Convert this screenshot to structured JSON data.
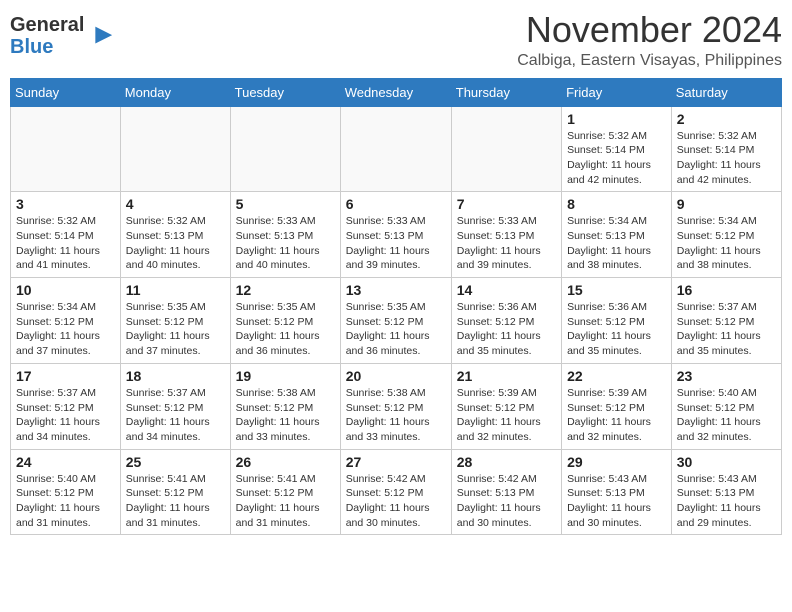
{
  "logo": {
    "general": "General",
    "blue": "Blue"
  },
  "title": "November 2024",
  "location": "Calbiga, Eastern Visayas, Philippines",
  "weekdays": [
    "Sunday",
    "Monday",
    "Tuesday",
    "Wednesday",
    "Thursday",
    "Friday",
    "Saturday"
  ],
  "weeks": [
    [
      {
        "day": "",
        "info": ""
      },
      {
        "day": "",
        "info": ""
      },
      {
        "day": "",
        "info": ""
      },
      {
        "day": "",
        "info": ""
      },
      {
        "day": "",
        "info": ""
      },
      {
        "day": "1",
        "info": "Sunrise: 5:32 AM\nSunset: 5:14 PM\nDaylight: 11 hours and 42 minutes."
      },
      {
        "day": "2",
        "info": "Sunrise: 5:32 AM\nSunset: 5:14 PM\nDaylight: 11 hours and 42 minutes."
      }
    ],
    [
      {
        "day": "3",
        "info": "Sunrise: 5:32 AM\nSunset: 5:14 PM\nDaylight: 11 hours and 41 minutes."
      },
      {
        "day": "4",
        "info": "Sunrise: 5:32 AM\nSunset: 5:13 PM\nDaylight: 11 hours and 40 minutes."
      },
      {
        "day": "5",
        "info": "Sunrise: 5:33 AM\nSunset: 5:13 PM\nDaylight: 11 hours and 40 minutes."
      },
      {
        "day": "6",
        "info": "Sunrise: 5:33 AM\nSunset: 5:13 PM\nDaylight: 11 hours and 39 minutes."
      },
      {
        "day": "7",
        "info": "Sunrise: 5:33 AM\nSunset: 5:13 PM\nDaylight: 11 hours and 39 minutes."
      },
      {
        "day": "8",
        "info": "Sunrise: 5:34 AM\nSunset: 5:13 PM\nDaylight: 11 hours and 38 minutes."
      },
      {
        "day": "9",
        "info": "Sunrise: 5:34 AM\nSunset: 5:12 PM\nDaylight: 11 hours and 38 minutes."
      }
    ],
    [
      {
        "day": "10",
        "info": "Sunrise: 5:34 AM\nSunset: 5:12 PM\nDaylight: 11 hours and 37 minutes."
      },
      {
        "day": "11",
        "info": "Sunrise: 5:35 AM\nSunset: 5:12 PM\nDaylight: 11 hours and 37 minutes."
      },
      {
        "day": "12",
        "info": "Sunrise: 5:35 AM\nSunset: 5:12 PM\nDaylight: 11 hours and 36 minutes."
      },
      {
        "day": "13",
        "info": "Sunrise: 5:35 AM\nSunset: 5:12 PM\nDaylight: 11 hours and 36 minutes."
      },
      {
        "day": "14",
        "info": "Sunrise: 5:36 AM\nSunset: 5:12 PM\nDaylight: 11 hours and 35 minutes."
      },
      {
        "day": "15",
        "info": "Sunrise: 5:36 AM\nSunset: 5:12 PM\nDaylight: 11 hours and 35 minutes."
      },
      {
        "day": "16",
        "info": "Sunrise: 5:37 AM\nSunset: 5:12 PM\nDaylight: 11 hours and 35 minutes."
      }
    ],
    [
      {
        "day": "17",
        "info": "Sunrise: 5:37 AM\nSunset: 5:12 PM\nDaylight: 11 hours and 34 minutes."
      },
      {
        "day": "18",
        "info": "Sunrise: 5:37 AM\nSunset: 5:12 PM\nDaylight: 11 hours and 34 minutes."
      },
      {
        "day": "19",
        "info": "Sunrise: 5:38 AM\nSunset: 5:12 PM\nDaylight: 11 hours and 33 minutes."
      },
      {
        "day": "20",
        "info": "Sunrise: 5:38 AM\nSunset: 5:12 PM\nDaylight: 11 hours and 33 minutes."
      },
      {
        "day": "21",
        "info": "Sunrise: 5:39 AM\nSunset: 5:12 PM\nDaylight: 11 hours and 32 minutes."
      },
      {
        "day": "22",
        "info": "Sunrise: 5:39 AM\nSunset: 5:12 PM\nDaylight: 11 hours and 32 minutes."
      },
      {
        "day": "23",
        "info": "Sunrise: 5:40 AM\nSunset: 5:12 PM\nDaylight: 11 hours and 32 minutes."
      }
    ],
    [
      {
        "day": "24",
        "info": "Sunrise: 5:40 AM\nSunset: 5:12 PM\nDaylight: 11 hours and 31 minutes."
      },
      {
        "day": "25",
        "info": "Sunrise: 5:41 AM\nSunset: 5:12 PM\nDaylight: 11 hours and 31 minutes."
      },
      {
        "day": "26",
        "info": "Sunrise: 5:41 AM\nSunset: 5:12 PM\nDaylight: 11 hours and 31 minutes."
      },
      {
        "day": "27",
        "info": "Sunrise: 5:42 AM\nSunset: 5:12 PM\nDaylight: 11 hours and 30 minutes."
      },
      {
        "day": "28",
        "info": "Sunrise: 5:42 AM\nSunset: 5:13 PM\nDaylight: 11 hours and 30 minutes."
      },
      {
        "day": "29",
        "info": "Sunrise: 5:43 AM\nSunset: 5:13 PM\nDaylight: 11 hours and 30 minutes."
      },
      {
        "day": "30",
        "info": "Sunrise: 5:43 AM\nSunset: 5:13 PM\nDaylight: 11 hours and 29 minutes."
      }
    ]
  ]
}
